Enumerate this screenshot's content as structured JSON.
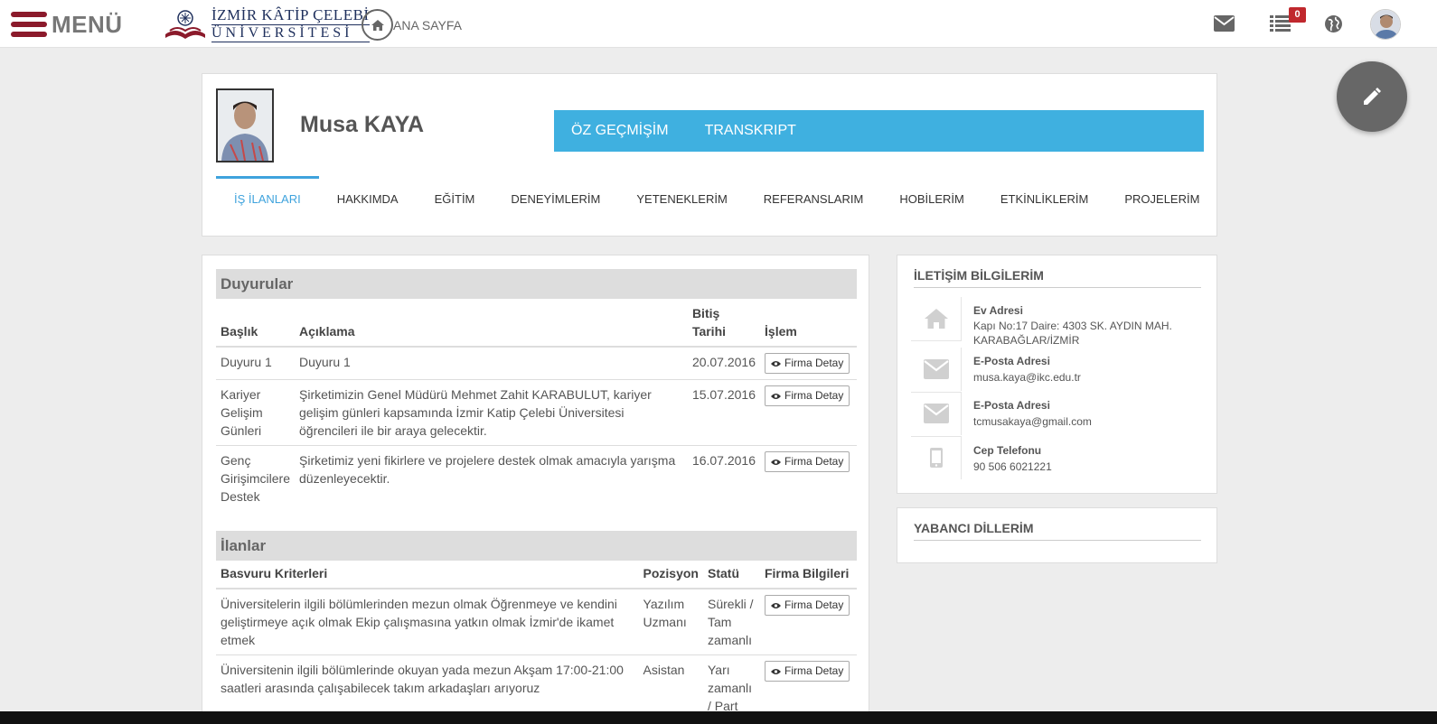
{
  "topbar": {
    "menu_label": "MENÜ",
    "logo_line1": "İZMİR KÂTİP ÇELEBİ",
    "logo_line2": "ÜNİVERSİTESİ",
    "home_label": "ANA SAYFA",
    "notification_count": "0",
    "icons": [
      "envelope-icon",
      "list-icon",
      "globe-icon",
      "avatar"
    ]
  },
  "profile": {
    "name": "Musa KAYA",
    "links": [
      "ÖZ GEÇMİŞİM",
      "TRANSKRIPT"
    ],
    "tabs": [
      "İŞ İLANLARI",
      "HAKKIMDA",
      "EĞİTİM",
      "DENEYİMLERİM",
      "YETENEKLERİM",
      "REFERANSLARIM",
      "HOBİLERİM",
      "ETKİNLİKLERİM",
      "PROJELERİM"
    ],
    "active_tab": "İŞ İLANLARI"
  },
  "duyurular": {
    "title": "Duyurular",
    "headers": {
      "baslik": "Başlık",
      "aciklama": "Açıklama",
      "bitis": "Bitiş Tarihi",
      "islem": "İşlem"
    },
    "rows": [
      {
        "baslik": "Duyuru 1",
        "aciklama": "Duyuru 1",
        "bitis": "20.07.2016",
        "button": "Firma Detay"
      },
      {
        "baslik": "Kariyer Gelişim Günleri",
        "aciklama": "Şirketimizin Genel Müdürü Mehmet Zahit KARABULUT, kariyer gelişim günleri kapsamında İzmir Katip Çelebi Üniversitesi öğrencileri ile bir araya gelecektir.",
        "bitis": "15.07.2016",
        "button": "Firma Detay"
      },
      {
        "baslik": "Genç Girişimcilere Destek",
        "aciklama": "Şirketimiz yeni fikirlere ve projelere destek olmak amacıyla yarışma düzenleyecektir.",
        "bitis": "16.07.2016",
        "button": "Firma Detay"
      }
    ]
  },
  "ilanlar": {
    "title": "İlanlar",
    "headers": {
      "kriter": "Basvuru Kriterleri",
      "pozisyon": "Pozisyon",
      "statu": "Statü",
      "firma": "Firma Bilgileri"
    },
    "rows": [
      {
        "kriter": "Üniversitelerin ilgili bölümlerinden mezun olmak Öğrenmeye ve kendini geliştirmeye açık olmak Ekip çalışmasına yatkın olmak İzmir'de ikamet etmek",
        "pozisyon": "Yazılım Uzmanı",
        "statu": "Sürekli / Tam zamanlı",
        "button": "Firma Detay"
      },
      {
        "kriter": "Üniversitenin ilgili bölümlerinde okuyan yada mezun Akşam 17:00-21:00 saatleri arasında çalışabilecek takım arkadaşları arıyoruz",
        "pozisyon": "Asistan",
        "statu": "Yarı zamanlı / Part",
        "button": "Firma Detay"
      }
    ]
  },
  "iletisim": {
    "title": "İLETİŞİM BİLGİLERİM",
    "items": [
      {
        "icon": "home-icon",
        "label": "Ev Adresi",
        "value": "Kapı No:17 Daire: 4303 SK. AYDIN MAH. KARABAĞLAR/İZMİR"
      },
      {
        "icon": "envelope-icon",
        "label": "E-Posta Adresi",
        "value": "musa.kaya@ikc.edu.tr"
      },
      {
        "icon": "envelope-icon",
        "label": "E-Posta Adresi",
        "value": "tcmusakaya@gmail.com"
      },
      {
        "icon": "mobile-icon",
        "label": "Cep Telefonu",
        "value": "90 506 6021221"
      }
    ]
  },
  "diller": {
    "title": "YABANCI DİLLERİM"
  },
  "colors": {
    "accent_blue": "#3fb0e0",
    "brand_red": "#8b1a2b",
    "badge_red": "#c0282d"
  }
}
